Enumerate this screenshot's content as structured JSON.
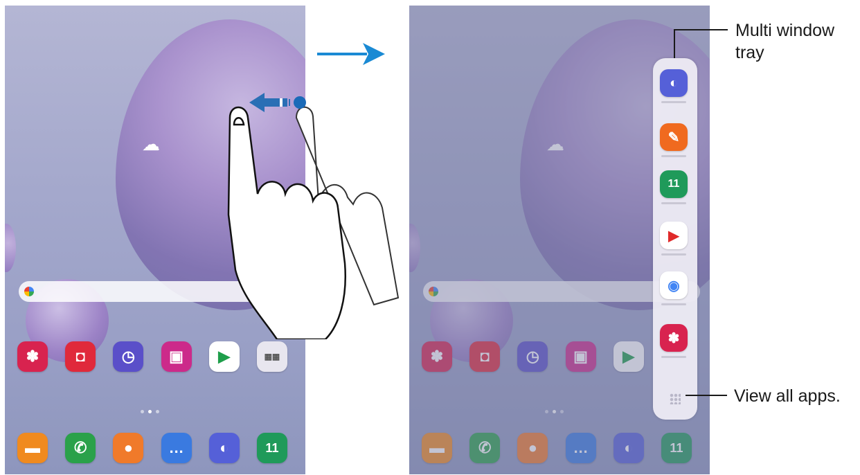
{
  "callouts": {
    "tray_line1": "Multi window",
    "tray_line2": "tray",
    "view_all": "View all apps."
  },
  "colors": {
    "arrow": "#1a8ad4",
    "finger_arrow": "#2a6fb5",
    "gallery": "#d8234f",
    "camera": "#e0293b",
    "clock": "#5a4fc9",
    "store": "#cc2a8a",
    "files": "#f08a1f",
    "phone": "#2aa14a",
    "contacts": "#f07a2a",
    "messages": "#3a7ae0",
    "internet": "#5560d8",
    "calendar": "#1f9a5a",
    "notes": "#f06a1f",
    "youtube": "#e02a2a"
  },
  "home_icons": [
    "gallery-icon",
    "camera-icon",
    "clock-icon",
    "galaxy-store-icon",
    "play-store-icon",
    "folder-icon"
  ],
  "dock_icons": [
    "my-files-icon",
    "phone-icon",
    "contacts-icon",
    "messages-icon",
    "internet-icon",
    "calendar-icon"
  ],
  "tray_icons": [
    "internet-icon",
    "samsung-notes-icon",
    "calendar-icon",
    "youtube-icon",
    "chrome-icon",
    "gallery-icon"
  ],
  "calendar_date": "11"
}
